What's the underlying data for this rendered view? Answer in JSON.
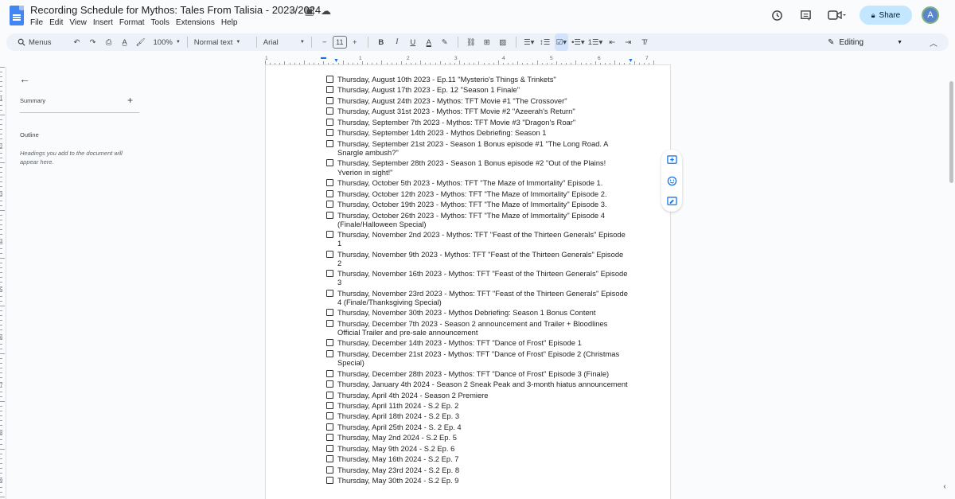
{
  "app": {
    "title": "Recording Schedule for Mythos: Tales From Talisia - 2023/2024",
    "menus": [
      "File",
      "Edit",
      "View",
      "Insert",
      "Format",
      "Tools",
      "Extensions",
      "Help"
    ],
    "share_label": "Share",
    "avatar_letter": "A"
  },
  "toolbar": {
    "menus_label": "Menus",
    "zoom": "100%",
    "style": "Normal text",
    "font": "Arial",
    "font_size": "11",
    "bold": "B",
    "italic": "I",
    "underline": "U",
    "text_color": "A",
    "minus": "−",
    "plus": "+",
    "mode_label": "Editing"
  },
  "ruler": {
    "numbers": [
      "1",
      "1",
      "2",
      "3",
      "4",
      "5",
      "6",
      "7"
    ]
  },
  "vruler": {
    "numbers": [
      "1",
      "2",
      "3",
      "4",
      "5",
      "6",
      "7",
      "8",
      "9"
    ]
  },
  "outline_panel": {
    "summary_label": "Summary",
    "outline_label": "Outline",
    "hint": "Headings you add to the document will appear here."
  },
  "document": {
    "items": [
      "Thursday, August 10th 2023 - Ep.11 \"Mysterio's Things & Trinkets\"",
      "Thursday, August 17th 2023 - Ep. 12 \"Season 1 Finale\"",
      "Thursday, August 24th 2023 - Mythos: TFT Movie #1 \"The Crossover\"",
      "Thursday, August 31st 2023 - Mythos: TFT Movie #2 \"Azeerah's Return\"",
      "Thursday, September 7th 2023 - Mythos: TFT Movie #3 \"Dragon's Roar\"",
      "Thursday, September 14th 2023 - Mythos Debriefing: Season 1",
      "Thursday, September 21st 2023 - Season 1 Bonus episode #1 \"The Long Road. A Snargle ambush?\"",
      "Thursday, September 28th 2023 - Season 1 Bonus episode #2 \"Out of the Plains! Yverion in sight!\"",
      "Thursday, October 5th 2023 - Mythos: TFT \"The Maze of Immortality\" Episode 1.",
      "Thursday, October 12th 2023 - Mythos: TFT \"The Maze of Immortality\" Episode 2.",
      "Thursday, October 19th 2023 - Mythos: TFT \"The Maze of Immortality\" Episode 3.",
      "Thursday, October 26th 2023 - Mythos: TFT \"The Maze of Immortality\" Episode 4 (Finale/Halloween Special)",
      "Thursday, November 2nd 2023 - Mythos: TFT \"Feast of the Thirteen Generals\" Episode 1",
      "Thursday, November 9th 2023 - Mythos: TFT \"Feast of the Thirteen Generals\" Episode 2",
      "Thursday, November 16th 2023 - Mythos: TFT \"Feast of the Thirteen Generals\" Episode 3",
      "Thursday, November 23rd 2023 - Mythos: TFT \"Feast of the Thirteen Generals\" Episode 4 (Finale/Thanksgiving Special)",
      "Thursday, November 30th 2023 - Mythos Debriefing: Season 1 Bonus Content",
      "Thursday, December 7th 2023 - Season 2 announcement and Trailer + Bloodlines Official Trailer and pre-sale announcement",
      "Thursday, December 14th 2023 - Mythos: TFT \"Dance of Frost\" Episode 1",
      "Thursday, December 21st 2023 - Mythos: TFT \"Dance of Frost\" Episode 2 (Christmas Special)",
      "Thursday, December 28th 2023 - Mythos: TFT \"Dance of Frost\" Episode 3 (Finale)",
      "Thursday, January 4th 2024  - Season 2 Sneak Peak and 3-month hiatus announcement",
      "Thursday, April 4th 2024 - Season 2 Premiere",
      "Thursday, April 11th 2024 - S.2 Ep. 2",
      "Thursday, April 18th 2024 - S.2 Ep. 3",
      "Thursday, April 25th 2024 - S. 2 Ep. 4",
      "Thursday, May 2nd 2024 - S.2 Ep. 5",
      "Thursday, May 9th 2024 - S.2 Ep. 6",
      "Thursday, May 16th 2024 - S.2 Ep. 7",
      "Thursday, May 23rd 2024 - S.2 Ep. 8",
      "Thursday, May 30th 2024 - S.2 Ep. 9"
    ]
  },
  "colors": {
    "accent": "#1a73e8",
    "share_bg": "#c2e7ff",
    "toolbar_bg": "#edf2fa"
  }
}
